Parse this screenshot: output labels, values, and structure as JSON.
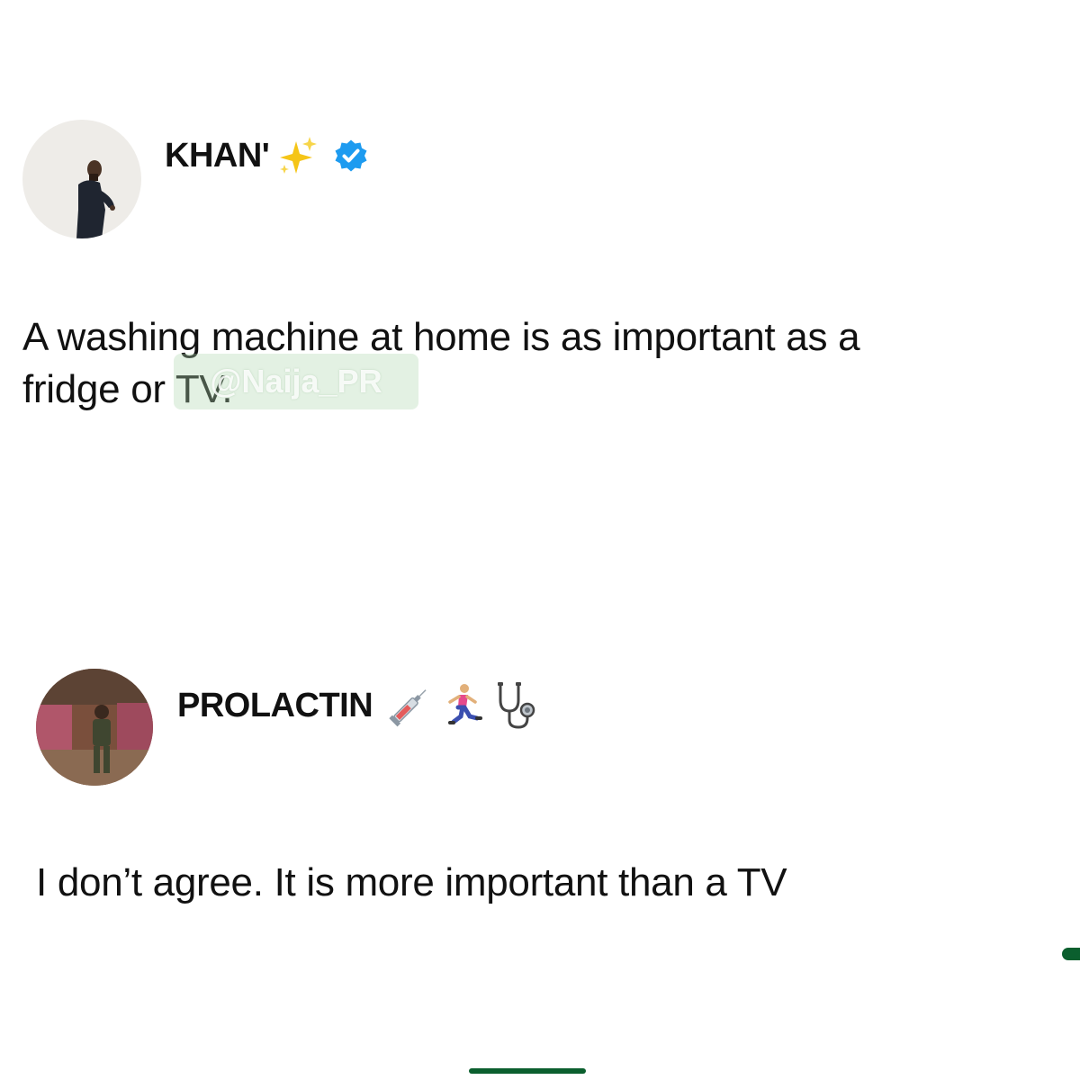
{
  "tweets": [
    {
      "display_name": "KHAN'",
      "name_emoji": "sparkles-icon",
      "verified": true,
      "text_line1": "A washing machine at home is as important as a",
      "text_line2": "fridge or TV."
    },
    {
      "display_name": "PROLACTIN",
      "name_emojis": [
        "syringe-icon",
        "runner-icon",
        "stethoscope-icon"
      ],
      "text": "I don’t agree. It is more important than a TV"
    }
  ],
  "watermark": {
    "text": "@Naija_PR"
  },
  "colors": {
    "verified_badge": "#1d9bf0",
    "accent_green": "#0b5f2e",
    "sparkle": "#f5c518"
  }
}
